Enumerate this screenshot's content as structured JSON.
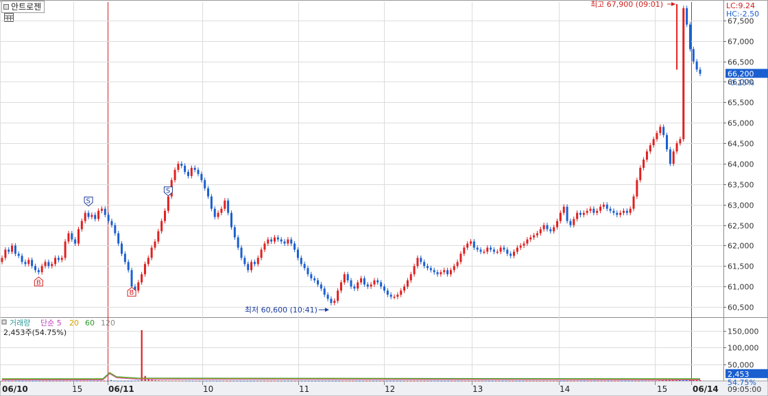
{
  "header": {
    "stock_name": "안트로젠",
    "lc_label": "LC:9.24",
    "hc_label": "HC:-2.50"
  },
  "price_panel": {
    "high_label": "최고 67,900 (09:01)",
    "low_label": "최저 60,600 (10:41)",
    "current_price": "66,200",
    "current_change": "-0.15%",
    "y_ticks": [
      "67,500",
      "67,000",
      "66,500",
      "66,000",
      "65,500",
      "65,000",
      "64,500",
      "64,000",
      "63,500",
      "63,000",
      "62,500",
      "62,000",
      "61,500",
      "61,000",
      "60,500"
    ]
  },
  "volume_panel": {
    "title": "거래량",
    "ma_labels": [
      {
        "text": "단순 5",
        "color": "#c040c0"
      },
      {
        "text": "20",
        "color": "#d4a000"
      },
      {
        "text": "60",
        "color": "#2a9a2a"
      },
      {
        "text": "120",
        "color": "#888888"
      }
    ],
    "current_value_label": "2,453주(54.75%)",
    "y_ticks": [
      "150,000",
      "100,000",
      "50,000"
    ],
    "current_volume": "2,453",
    "current_pct": "54.75%"
  },
  "x_axis": {
    "labels": [
      {
        "text": "06/10",
        "bold": true
      },
      {
        "text": "15",
        "bold": false
      },
      {
        "text": "06/11",
        "bold": true
      },
      {
        "text": "10",
        "bold": false
      },
      {
        "text": "11",
        "bold": false
      },
      {
        "text": "12",
        "bold": false
      },
      {
        "text": "13",
        "bold": false
      },
      {
        "text": "14",
        "bold": false
      },
      {
        "text": "15",
        "bold": false
      },
      {
        "text": "06/14",
        "bold": true
      }
    ],
    "time_label": "09:05:00"
  },
  "markers": [
    {
      "text": "B",
      "type": "buy",
      "price": 61350
    },
    {
      "text": "S",
      "type": "sell",
      "price": 62850
    },
    {
      "text": "B",
      "type": "buy",
      "price": 61100
    },
    {
      "text": "S",
      "type": "sell",
      "price": 63100
    }
  ],
  "colors": {
    "up": "#e02020",
    "down": "#1a5fd0",
    "grid": "#dcdcdc",
    "day_line": "#d02020",
    "axis_text": "#333333",
    "price_box": "#1a5fd0"
  },
  "chart_data": {
    "type": "candlestick",
    "price_range": [
      60250,
      67950
    ],
    "volume_range": [
      0,
      160000
    ],
    "high": {
      "price": 67900,
      "time": "09:01"
    },
    "low": {
      "price": 60600,
      "time": "10:41"
    },
    "close_series": [
      61700,
      61900,
      61850,
      62000,
      61800,
      61750,
      61600,
      61550,
      61650,
      61500,
      61400,
      61350,
      61500,
      61600,
      61500,
      61550,
      61700,
      61650,
      61700,
      62100,
      62300,
      62150,
      62050,
      62400,
      62600,
      62800,
      62700,
      62750,
      62650,
      62850,
      62900,
      62750,
      62600,
      62500,
      62300,
      62050,
      61800,
      61600,
      61400,
      61000,
      60900,
      61100,
      61300,
      61550,
      61700,
      61950,
      62100,
      62350,
      62600,
      62850,
      63200,
      63600,
      63850,
      64000,
      63950,
      63800,
      63700,
      63900,
      63850,
      63750,
      63600,
      63400,
      63200,
      62900,
      62700,
      62800,
      62900,
      63100,
      62800,
      62450,
      62200,
      61950,
      61700,
      61550,
      61400,
      61600,
      61550,
      61700,
      61900,
      62050,
      62150,
      62100,
      62200,
      62150,
      62100,
      62050,
      62150,
      62050,
      61900,
      61700,
      61550,
      61450,
      61300,
      61200,
      61150,
      61050,
      60950,
      60800,
      60700,
      60600,
      60650,
      60900,
      61100,
      61300,
      61150,
      61000,
      60950,
      61100,
      61200,
      61050,
      61000,
      61050,
      61150,
      61100,
      61000,
      60900,
      60800,
      60750,
      60750,
      60800,
      60900,
      61000,
      61150,
      61300,
      61500,
      61700,
      61600,
      61500,
      61450,
      61400,
      61350,
      61300,
      61350,
      61400,
      61300,
      61400,
      61500,
      61600,
      61800,
      61950,
      62050,
      62100,
      61950,
      61900,
      61850,
      61850,
      61950,
      61900,
      61850,
      61850,
      61950,
      61900,
      61800,
      61750,
      61850,
      61950,
      62000,
      62050,
      62150,
      62200,
      62250,
      62300,
      62400,
      62500,
      62400,
      62350,
      62450,
      62600,
      62800,
      62950,
      62600,
      62500,
      62650,
      62800,
      62750,
      62800,
      62850,
      62900,
      62800,
      62850,
      62950,
      63000,
      62900,
      62850,
      62800,
      62750,
      62800,
      62850,
      62800,
      62900,
      63200,
      63600,
      63900,
      64100,
      64300,
      64450,
      64600,
      64750,
      64900,
      64700,
      64350,
      64000,
      64300,
      64500,
      64600,
      67800,
      67400,
      66800,
      66500,
      66300,
      66200
    ],
    "volumes": [
      600,
      300,
      200,
      400,
      300,
      200,
      200,
      300,
      200,
      150,
      400,
      300,
      200,
      300,
      200,
      200,
      300,
      200,
      250,
      400,
      500,
      600,
      300,
      400,
      500,
      600,
      400,
      300,
      200,
      300,
      300,
      200,
      2500,
      800,
      400,
      600,
      300,
      400,
      500,
      900,
      1500,
      152000,
      15000,
      6000,
      3500,
      2500,
      1800,
      1500,
      1200,
      900,
      800,
      1000,
      700,
      600,
      500,
      400,
      500,
      400,
      300,
      300,
      400,
      500,
      600,
      300,
      400,
      500,
      300,
      300,
      400,
      300,
      300,
      200,
      300,
      200,
      200,
      300,
      200,
      300,
      200,
      200,
      300,
      200,
      200,
      200,
      200,
      200,
      200,
      300,
      200,
      200,
      300,
      200,
      200,
      300,
      200,
      300,
      200,
      300,
      200,
      200,
      300,
      400,
      300,
      200,
      200,
      200,
      200,
      200,
      300,
      200,
      200,
      200,
      300,
      200,
      200,
      200,
      300,
      200,
      200,
      300,
      200,
      200,
      200,
      200,
      200,
      200,
      200,
      300,
      200,
      200,
      200,
      200,
      200,
      200,
      200,
      200,
      200,
      200,
      200,
      200,
      200,
      200,
      300,
      200,
      200,
      200,
      200,
      200,
      200,
      200,
      200,
      200,
      200,
      200,
      200,
      200,
      200,
      200,
      200,
      200,
      200,
      300,
      200,
      200,
      200,
      200,
      200,
      200,
      200,
      300,
      200,
      200,
      200,
      200,
      200,
      200,
      300,
      200,
      200,
      200,
      200,
      200,
      200,
      200,
      200,
      200,
      200,
      200,
      300,
      400,
      500,
      600,
      800,
      1500,
      2000,
      3000,
      4000,
      3500,
      2800,
      3000,
      2000,
      3800,
      3000,
      4500,
      3500,
      2453
    ],
    "ma_series": [
      {
        "name": "단순 5",
        "color": "#c040c0"
      },
      {
        "name": "20",
        "color": "#d4a000"
      },
      {
        "name": "60",
        "color": "#2a9a2a"
      },
      {
        "name": "120",
        "color": "#888888"
      }
    ]
  }
}
